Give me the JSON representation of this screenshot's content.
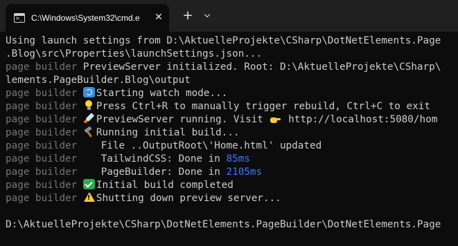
{
  "window": {
    "tab_title": "C:\\Windows\\System32\\cmd.e",
    "tab_icon": "cmd-icon",
    "close_glyph": "✕",
    "new_tab_glyph": "+",
    "dropdown_icon": "chevron-down-icon"
  },
  "console": {
    "lines": [
      {
        "text": "Using launch settings from D:\\AktuelleProjekte\\CSharp\\DotNetElements.Page"
      },
      {
        "text": ".Blog\\src\\Properties\\launchSettings.json..."
      },
      {
        "prefix": "page builder",
        "text": " PreviewServer initialized. Root: D:\\AktuelleProjekte\\CSharp\\"
      },
      {
        "text": "lements.PageBuilder.Blog\\output"
      },
      {
        "prefix": "page builder",
        "emoji": "counterclockwise-arrows-icon",
        "text": "Starting watch mode..."
      },
      {
        "prefix": "page builder",
        "emoji": "light-bulb-icon",
        "text": "Press Ctrl+R to manually trigger rebuild, Ctrl+C to exit"
      },
      {
        "prefix": "page builder",
        "emoji": "rocket-icon",
        "text": "PreviewServer running. Visit ",
        "emoji2": "backhand-pointing-right-icon",
        "text2": " http://localhost:5080/hom"
      },
      {
        "prefix": "page builder",
        "emoji": "hammer-icon",
        "text": "Running initial build..."
      },
      {
        "prefix": "page builder",
        "text": "    File ..OutputRoot\\'Home.html' updated"
      },
      {
        "prefix": "page builder",
        "text": "    TailwindCSS: Done in ",
        "highlight": "85ms"
      },
      {
        "prefix": "page builder",
        "text": "    PageBuilder: Done in ",
        "highlight": "2105ms"
      },
      {
        "prefix": "page builder",
        "emoji": "check-mark-button-icon",
        "text": "Initial build completed"
      },
      {
        "prefix": "page builder",
        "emoji": "warning-icon",
        "text": "Shutting down preview server..."
      },
      {
        "text": ""
      },
      {
        "text": "D:\\AktuelleProjekte\\CSharp\\DotNetElements.PageBuilder\\DotNetElements.Page"
      }
    ]
  },
  "colors": {
    "background": "#0c0c0c",
    "titlebar": "#202020",
    "text": "#cccccc",
    "prefix": "#767676",
    "timing": "#3b78ff"
  }
}
